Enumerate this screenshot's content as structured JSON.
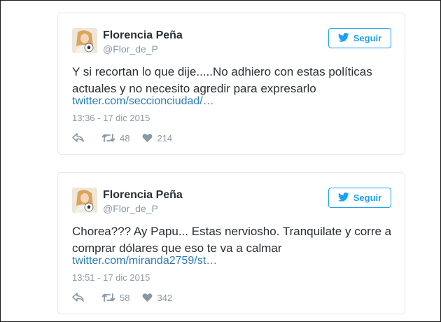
{
  "colors": {
    "accent": "#1da1f2",
    "link": "#2b7bb9",
    "muted": "#8899a6",
    "text": "#292f33"
  },
  "tweets": [
    {
      "author_name": "Florencia Peña",
      "handle": "@Flor_de_P",
      "follow_label": "Seguir",
      "text": "Y si recortan lo que dije.....No adhiero con estas políticas actuales y no necesito agredir para expresarlo",
      "link": "twitter.com/seccionciudad/…",
      "timestamp": "13:36 - 17 dic 2015",
      "retweets": "48",
      "likes": "214"
    },
    {
      "author_name": "Florencia Peña",
      "handle": "@Flor_de_P",
      "follow_label": "Seguir",
      "text": "Chorea??? Ay Papu... Estas nerviosho. Tranquilate y corre a comprar dólares que eso te va a calmar",
      "link": "twitter.com/miranda2759/st…",
      "timestamp": "13:51 - 17 dic 2015",
      "retweets": "58",
      "likes": "342"
    }
  ]
}
